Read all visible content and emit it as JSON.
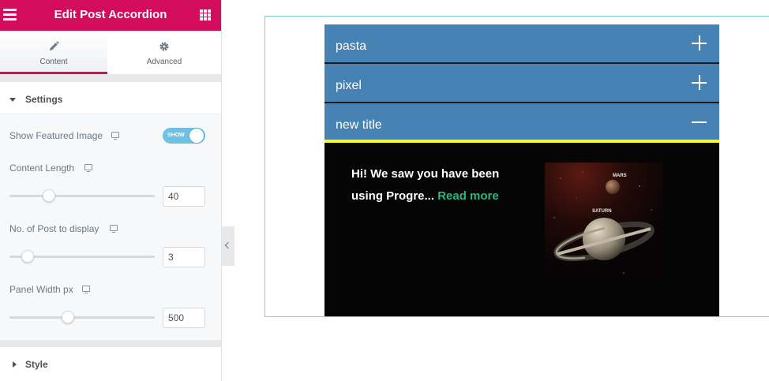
{
  "panel": {
    "title": "Edit Post Accordion",
    "tabs": [
      {
        "label": "Content",
        "icon": "pencil-icon",
        "active": true
      },
      {
        "label": "Advanced",
        "icon": "gear-icon",
        "active": false
      }
    ],
    "sections": {
      "settings_title": "Settings",
      "style_title": "Style"
    },
    "controls": {
      "featured_label": "Show Featured Image",
      "featured_toggle": "SHOW",
      "content_length_label": "Content Length",
      "content_length_value": "40",
      "posts_label": "No. of Post to display",
      "posts_value": "3",
      "panel_width_label": "Panel Width px",
      "panel_width_value": "500"
    }
  },
  "preview": {
    "items": [
      {
        "title": "pasta",
        "state": "collapsed"
      },
      {
        "title": "pixel",
        "state": "collapsed"
      },
      {
        "title": "new title",
        "state": "expanded"
      }
    ],
    "excerpt": "Hi! We saw you have been using Progre...",
    "read_more": "Read more",
    "image_labels": {
      "top": "MARS",
      "bottom": "SATURN"
    }
  },
  "colors": {
    "brand": "#d30c5c",
    "accordion_header": "#4682b4",
    "active_underline": "#ffff00",
    "read_more": "#2fb57f",
    "content_bg": "#050505"
  }
}
